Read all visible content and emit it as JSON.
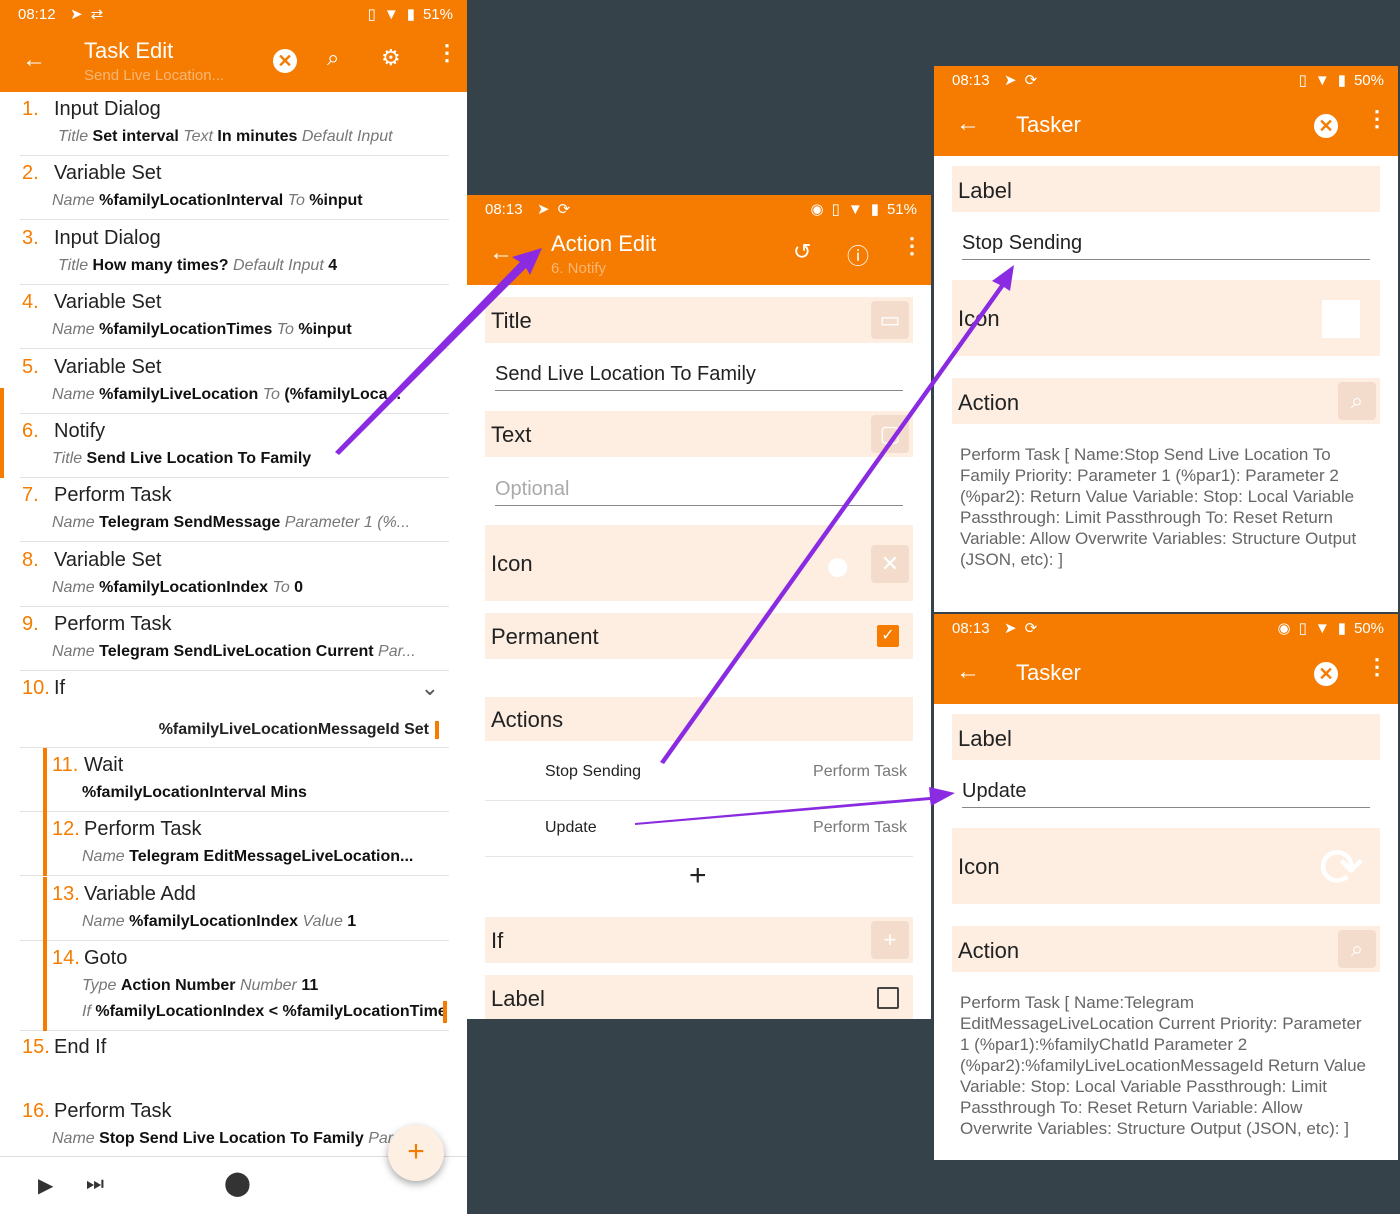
{
  "left": {
    "status": {
      "time": "08:12",
      "battery": "51%"
    },
    "toolbar": {
      "title": "Task Edit",
      "subtitle": "Send Live Location..."
    },
    "actions": [
      {
        "num": "1.",
        "name": "Input Dialog",
        "detail": [
          {
            "k": "Title",
            "v": "Set interval"
          },
          {
            "k": "Text",
            "v": "In minutes"
          },
          {
            "k": "Default Input",
            "v": ""
          }
        ]
      },
      {
        "num": "2.",
        "name": "Variable Set",
        "detail": [
          {
            "k": "Name",
            "v": "%familyLocationInterval"
          },
          {
            "k": "To",
            "v": "%input"
          }
        ]
      },
      {
        "num": "3.",
        "name": "Input Dialog",
        "detail": [
          {
            "k": "Title",
            "v": "How many times?"
          },
          {
            "k": "Default Input",
            "v": "4"
          }
        ]
      },
      {
        "num": "4.",
        "name": "Variable Set",
        "detail": [
          {
            "k": "Name",
            "v": "%familyLocationTimes"
          },
          {
            "k": "To",
            "v": "%input"
          }
        ]
      },
      {
        "num": "5.",
        "name": "Variable Set",
        "detail": [
          {
            "k": "Name",
            "v": "%familyLiveLocation"
          },
          {
            "k": "To",
            "v": "(%familyLoca..."
          }
        ]
      },
      {
        "num": "6.",
        "name": "Notify",
        "detail": [
          {
            "k": "Title",
            "v": "Send Live Location To Family"
          }
        ]
      },
      {
        "num": "7.",
        "name": "Perform Task",
        "detail": [
          {
            "k": "Name",
            "v": "Telegram SendMessage"
          },
          {
            "k": "Parameter 1 (%...",
            "v": ""
          }
        ]
      },
      {
        "num": "8.",
        "name": "Variable Set",
        "detail": [
          {
            "k": "Name",
            "v": "%familyLocationIndex"
          },
          {
            "k": "To",
            "v": "0"
          }
        ]
      },
      {
        "num": "9.",
        "name": "Perform Task",
        "detail": [
          {
            "k": "Name",
            "v": "Telegram SendLiveLocation Current"
          },
          {
            "k": "Par...",
            "v": ""
          }
        ]
      },
      {
        "num": "10.",
        "name": "If",
        "condition": "%familyLiveLocationMessageId Set"
      },
      {
        "num": "11.",
        "name": "Wait",
        "detail": [
          {
            "k": "",
            "v": "%familyLocationInterval Mins"
          }
        ]
      },
      {
        "num": "12.",
        "name": "Perform Task",
        "detail": [
          {
            "k": "Name",
            "v": "Telegram EditMessageLiveLocation..."
          }
        ]
      },
      {
        "num": "13.",
        "name": "Variable Add",
        "detail": [
          {
            "k": "Name",
            "v": "%familyLocationIndex"
          },
          {
            "k": "Value",
            "v": "1"
          }
        ]
      },
      {
        "num": "14.",
        "name": "Goto",
        "detail": [
          {
            "k": "Type",
            "v": "Action Number"
          },
          {
            "k": "Number",
            "v": "11"
          }
        ],
        "detail2": [
          {
            "k": "If",
            "v": "%familyLocationIndex < %familyLocationTimes"
          }
        ]
      },
      {
        "num": "15.",
        "name": "End If"
      },
      {
        "num": "16.",
        "name": "Perform Task",
        "detail": [
          {
            "k": "Name",
            "v": "Stop Send Live Location To Family"
          },
          {
            "k": "Par",
            "v": ""
          }
        ]
      }
    ]
  },
  "middle": {
    "status": {
      "time": "08:13",
      "battery": "51%"
    },
    "toolbar": {
      "title": "Action Edit",
      "subtitle": "6. Notify"
    },
    "title_label": "Title",
    "title_value": "Send Live Location To Family",
    "text_label": "Text",
    "text_placeholder": "Optional",
    "icon_label": "Icon",
    "permanent_label": "Permanent",
    "actions_label": "Actions",
    "action_rows": [
      {
        "name": "Stop Sending",
        "type": "Perform Task"
      },
      {
        "name": "Update",
        "type": "Perform Task"
      }
    ],
    "add_symbol": "+",
    "if_label": "If",
    "label_label": "Label"
  },
  "top_right": {
    "status": {
      "time": "08:13",
      "battery": "50%"
    },
    "toolbar": {
      "title": "Tasker"
    },
    "label_label": "Label",
    "label_value": "Stop Sending",
    "icon_label": "Icon",
    "action_label": "Action",
    "action_desc": "Perform Task [ Name:Stop Send Live Location To Family Priority: Parameter 1 (%par1): Parameter 2 (%par2): Return Value Variable: Stop: Local Variable Passthrough: Limit Passthrough To: Reset Return Variable: Allow Overwrite Variables: Structure Output (JSON, etc): ]"
  },
  "bottom_right": {
    "status": {
      "time": "08:13",
      "battery": "50%"
    },
    "toolbar": {
      "title": "Tasker"
    },
    "label_label": "Label",
    "label_value": "Update",
    "icon_label": "Icon",
    "action_label": "Action",
    "action_desc": "Perform Task [ Name:Telegram EditMessageLiveLocation Current Priority: Parameter 1 (%par1):%familyChatId Parameter 2 (%par2):%familyLiveLocationMessageId Return Value Variable: Stop: Local Variable Passthrough: Limit Passthrough To: Reset Return Variable: Allow Overwrite Variables: Structure Output (JSON, etc): ]"
  },
  "colors": {
    "accent": "#f57c00",
    "band": "#fdeee1",
    "arrow": "#8a2be2",
    "background": "#36424a"
  },
  "icons": [
    "back-arrow-icon",
    "clear-circle-icon",
    "search-icon",
    "gear-icon",
    "more-vert-icon",
    "undo-icon",
    "help-icon",
    "play-icon",
    "skip-next-icon",
    "location-pin-icon",
    "plus-icon",
    "checkbox-icon",
    "refresh-icon"
  ]
}
